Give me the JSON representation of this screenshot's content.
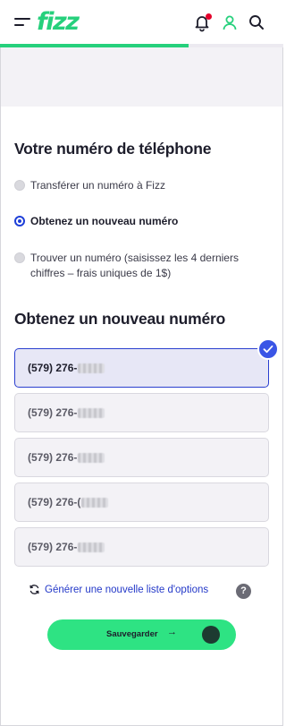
{
  "header": {
    "logo": "fizz",
    "progress_fraction": 0.665,
    "notification": true,
    "icons": [
      "menu-icon",
      "bell-icon",
      "user-icon",
      "search-icon"
    ],
    "brand_color": "#26d07c"
  },
  "phone_section": {
    "title": "Votre numéro de téléphone",
    "options": [
      {
        "label": "Transférer un numéro à Fizz",
        "selected": false
      },
      {
        "label": "Obtenez un nouveau numéro",
        "selected": true
      },
      {
        "label": "Trouver un numéro (saisissez les 4 derniers chiffres – frais uniques de 1$)",
        "selected": false
      }
    ]
  },
  "new_number_section": {
    "title": "Obtenez un nouveau numéro",
    "numbers": [
      {
        "prefix": "(579) 276-",
        "selected": true
      },
      {
        "prefix": "(579) 276-",
        "selected": false
      },
      {
        "prefix": "(579) 276-",
        "selected": false
      },
      {
        "prefix": "(579) 276-(",
        "selected": false
      },
      {
        "prefix": "(579) 276-",
        "selected": false
      }
    ],
    "regenerate_label": "Générer une nouvelle liste d'options",
    "help_label": "?"
  },
  "save_button": {
    "label": "Sauvegarder",
    "arrow": "→"
  },
  "colors": {
    "accent_blue": "#2a3fcf",
    "button_green": "#2ee383",
    "link_blue": "#2338c8"
  }
}
